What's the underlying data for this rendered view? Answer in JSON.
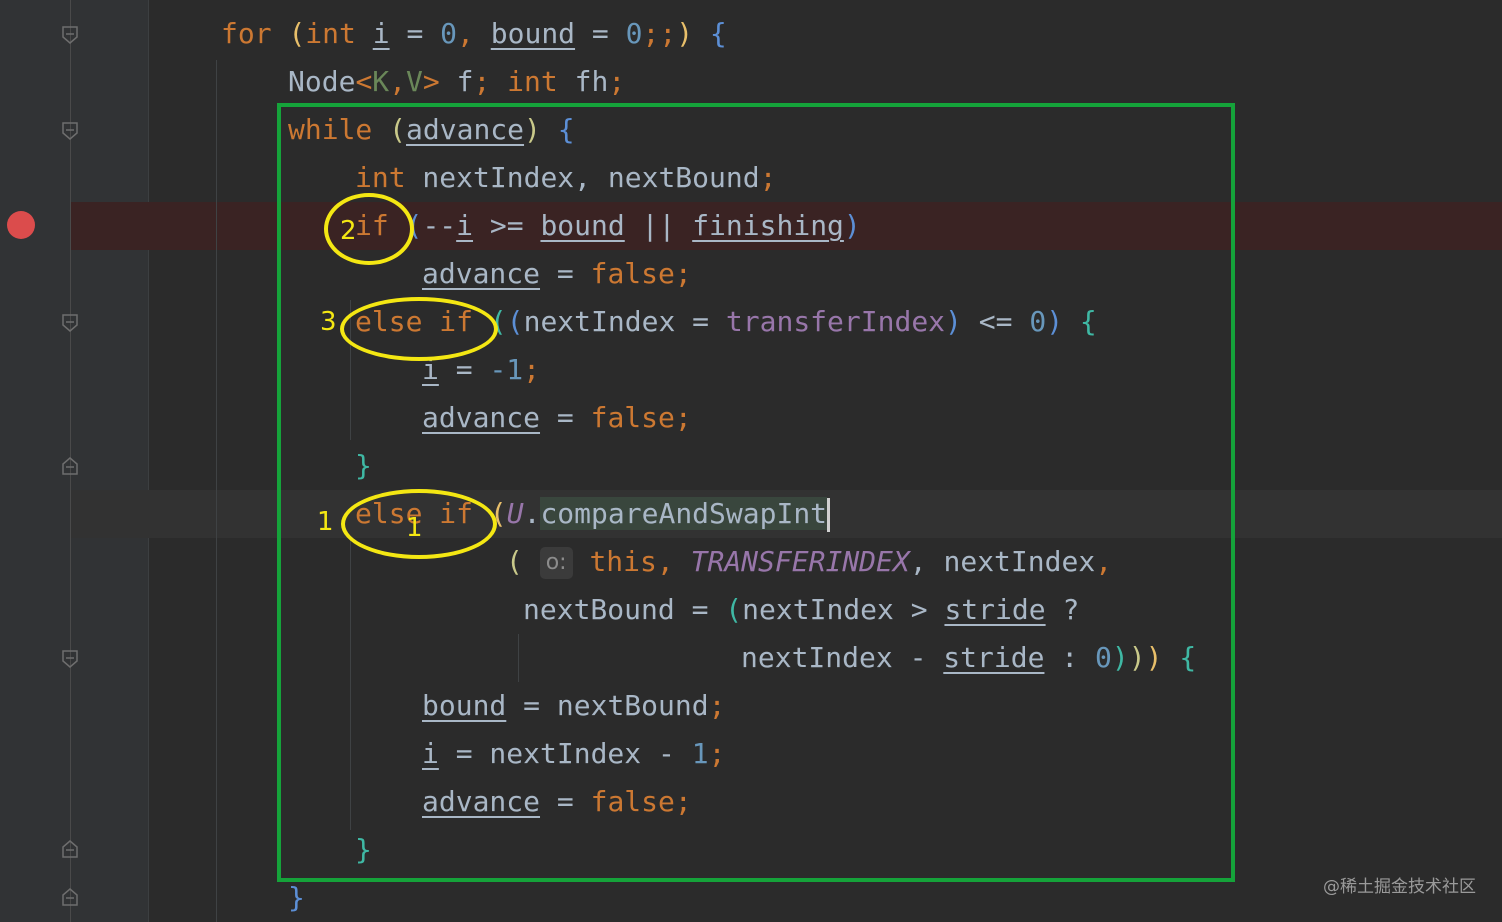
{
  "editor": {
    "lines": {
      "l1": {
        "for": "for",
        "p_open": "(",
        "int": "int",
        "i": "i",
        "eq1": " = ",
        "zero": "0",
        "comma": ", ",
        "bound": "bound",
        "eq2": " = ",
        "zero2": "0",
        "semis": ";;",
        "p_close": ")",
        "brace": " {"
      },
      "l2": {
        "node": "Node",
        "lt": "<",
        "k": "K",
        "comma": ",",
        "v": "V",
        "gt": ">",
        "f": " f",
        "semi1": ";",
        "int": " int",
        "fh": " fh",
        "semi2": ";"
      },
      "l3": {
        "while": "while",
        "p_open": " (",
        "advance": "advance",
        "p_close": ")",
        "brace": " {"
      },
      "l4": {
        "int": "int",
        "rest": " nextIndex, nextBound",
        "semi": ";"
      },
      "l5": {
        "if": "if",
        "p_open": " (",
        "pre": "--",
        "i": "i",
        "ge": " >= ",
        "bound": "bound",
        "or": " || ",
        "finishing": "finishing",
        "p_close": ")"
      },
      "l6": {
        "advance": "advance",
        "eq": " = ",
        "false": "false",
        "semi": ";"
      },
      "l7": {
        "else_if": "else if",
        "p_open": " (",
        "p_open2": "(",
        "next": "nextIndex = ",
        "transfer": "transferIndex",
        "p_close2": ")",
        "le": " <= ",
        "zero": "0",
        "p_close": ")",
        "brace": " {"
      },
      "l8": {
        "i": "i",
        "eq": " = ",
        "neg": "-1",
        "semi": ";"
      },
      "l9": {
        "advance": "advance",
        "eq": " = ",
        "false": "false",
        "semi": ";"
      },
      "l10": {
        "brace": "}"
      },
      "l11": {
        "else_if": "else if",
        "p_open": " (",
        "u": "U",
        "dot": ".",
        "method": "compareAndSwapInt"
      },
      "l12": {
        "p_open": "(",
        "hint": "o:",
        "this": " this",
        "comma": ", ",
        "const": "TRANSFERINDEX",
        "rest": ", nextIndex",
        "comma2": ","
      },
      "l13": {
        "lhs": "nextBound = ",
        "p_open": "(",
        "mid": "nextIndex > ",
        "stride": "stride",
        "q": " ?"
      },
      "l14": {
        "mid": "nextIndex - ",
        "stride": "stride",
        "colon": " : ",
        "zero": "0",
        "c1": ")",
        "c2": ")",
        "c3": ")",
        "brace": " {"
      },
      "l15": {
        "bound": "bound",
        "rest": " = nextBound",
        "semi": ";"
      },
      "l16": {
        "i": "i",
        "rest": " = nextIndex - ",
        "one": "1",
        "semi": ";"
      },
      "l17": {
        "advance": "advance",
        "eq": " = ",
        "false": "false",
        "semi": ";"
      },
      "l18": {
        "brace": "}"
      },
      "l19": {
        "brace": "}"
      }
    }
  },
  "annotations": {
    "n2": "2",
    "n3": "3",
    "n1": "1",
    "n1b": "1"
  },
  "watermark": "@稀土掘金技术社区",
  "colors": {
    "keyword": "#cc7832",
    "number": "#6897bb",
    "field": "#9876aa",
    "text": "#a9b7c6",
    "highlight_box": "#15a33a",
    "annotation": "#f4e713",
    "breakpoint": "#db4c4c"
  }
}
